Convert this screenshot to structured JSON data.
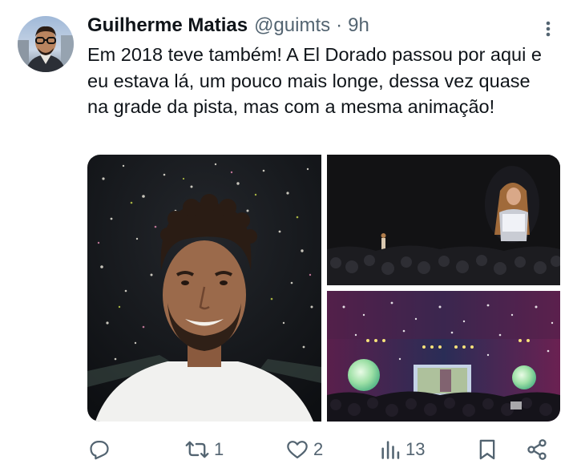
{
  "tweet": {
    "display_name": "Guilherme Matias",
    "handle": "@guimts",
    "separator": "·",
    "time": "9h",
    "text": "Em 2018 teve também! A El Dorado passou por aqui e eu estava lá, um pouco mais longe, dessa vez quase na grade da pista, mas com a mesma animação!",
    "media": [
      {
        "kind": "selfie-confetti"
      },
      {
        "kind": "concert-stage-screen"
      },
      {
        "kind": "concert-confetti-stage"
      }
    ]
  },
  "actions": {
    "reply": {
      "icon": "reply-icon",
      "count": ""
    },
    "retweet": {
      "icon": "retweet-icon",
      "count": "1"
    },
    "like": {
      "icon": "heart-icon",
      "count": "2"
    },
    "views": {
      "icon": "views-icon",
      "count": "13"
    },
    "bookmark": {
      "icon": "bookmark-icon"
    },
    "share": {
      "icon": "share-icon"
    }
  },
  "colors": {
    "text": "#0f1419",
    "secondary": "#536471"
  }
}
